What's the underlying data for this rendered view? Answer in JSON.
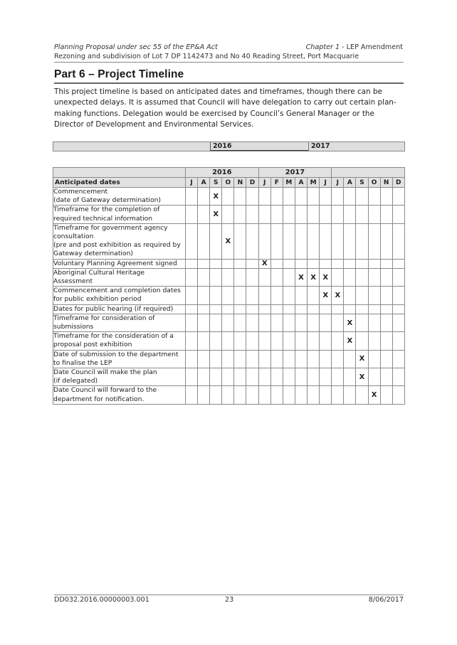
{
  "header": {
    "left_line1": "Planning Proposal under sec 55 of the EP&A Act",
    "right_italic": "Chapter 1",
    "right_rest": " - LEP Amendment",
    "line2": "Rezoning and subdivision of Lot 7 DP 1142473 and No 40 Reading Street, Port Macquarie"
  },
  "section": {
    "title": "Part 6 – Project Timeline",
    "intro": "This project timeline is based on anticipated dates and timeframes, though there can be unexpected delays.  It is assumed that Council will have delegation to carry out certain plan-making functions.  Delegation would be exercised by Council’s General Manager or the Director of Development and Environmental Services."
  },
  "topbar": {
    "year1": "2016",
    "year2": "2017"
  },
  "timeline": {
    "label_header": "Anticipated dates",
    "year_groups": [
      {
        "label": "2016",
        "span": 6
      },
      {
        "label": "2017",
        "span": 6
      },
      {
        "label": "",
        "span": 6
      }
    ],
    "months": [
      "J",
      "A",
      "S",
      "O",
      "N",
      "D",
      "J",
      "F",
      "M",
      "A",
      "M",
      "J",
      "J",
      "A",
      "S",
      "O",
      "N",
      "D"
    ],
    "marker": "X",
    "rows": [
      {
        "lines": [
          "Commencement",
          "(date of Gateway determination)"
        ],
        "marks": [
          2
        ]
      },
      {
        "lines": [
          "Timeframe for the completion of",
          "required technical information"
        ],
        "marks": [
          2
        ]
      },
      {
        "lines": [
          "Timeframe for government agency",
          "consultation",
          "(pre and post exhibition as required by",
          "Gateway determination)"
        ],
        "marks": [
          3
        ]
      },
      {
        "lines": [
          "Voluntary Planning Agreement signed"
        ],
        "marks": [
          6
        ]
      },
      {
        "lines": [
          "Aboriginal Cultural Heritage Assessment"
        ],
        "marks": [
          9,
          10,
          11
        ]
      },
      {
        "lines": [
          "Commencement and completion dates",
          "for public exhibition period"
        ],
        "marks": [
          11,
          12
        ]
      },
      {
        "lines": [
          "Dates for public hearing (if required)"
        ],
        "marks": []
      },
      {
        "lines": [
          "Timeframe for consideration of",
          "submissions"
        ],
        "marks": [
          13
        ]
      },
      {
        "lines": [
          "Timeframe for the consideration of a",
          "proposal post exhibition"
        ],
        "marks": [
          13
        ]
      },
      {
        "lines": [
          "Date of submission to the department",
          "to finalise the LEP"
        ],
        "marks": [
          14
        ]
      },
      {
        "lines": [
          "Date Council will make the plan",
          "(if delegated)"
        ],
        "marks": [
          14
        ]
      },
      {
        "lines": [
          "Date Council will forward to the",
          "department for notification."
        ],
        "marks": [
          15
        ]
      }
    ]
  },
  "footer": {
    "doc_id": "DD032.2016.00000003.001",
    "page_number": "23",
    "date": "8/06/2017"
  }
}
